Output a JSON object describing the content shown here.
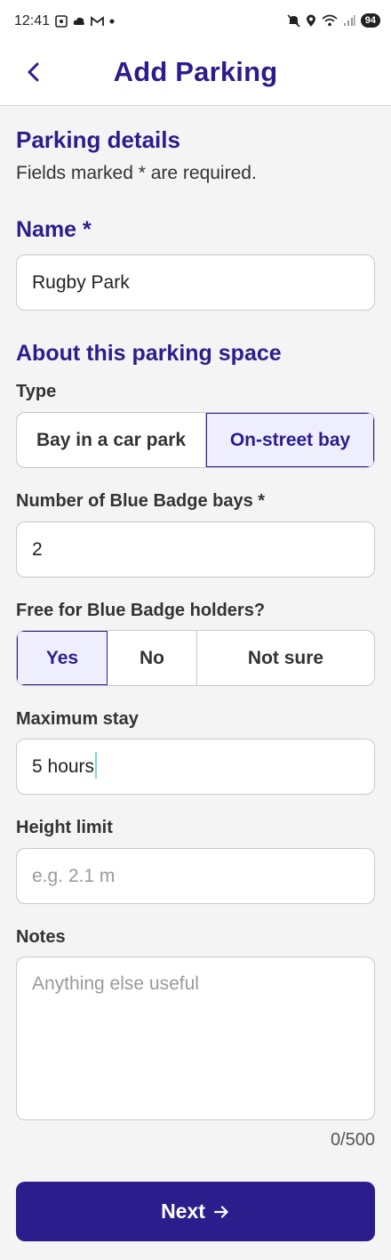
{
  "status_bar": {
    "time": "12:41",
    "battery": "94"
  },
  "app_bar": {
    "title": "Add Parking",
    "back_icon": "chevron-left-icon"
  },
  "form": {
    "section_title": "Parking details",
    "required_note": "Fields marked * are required.",
    "name": {
      "label": "Name *",
      "value": "Rugby Park"
    },
    "about_title": "About this parking space",
    "type": {
      "label": "Type",
      "options": [
        "Bay in a car park",
        "On-street bay"
      ],
      "selected": "On-street bay"
    },
    "bays": {
      "label": "Number of Blue Badge bays *",
      "value": "2"
    },
    "free": {
      "label": "Free for Blue Badge holders?",
      "options": [
        "Yes",
        "No",
        "Not sure"
      ],
      "selected": "Yes"
    },
    "max_stay": {
      "label": "Maximum stay",
      "value": "5 hours"
    },
    "height": {
      "label": "Height limit",
      "placeholder": "e.g. 2.1 m"
    },
    "notes": {
      "label": "Notes",
      "placeholder": "Anything else useful",
      "counter": "0/500"
    },
    "next_button": {
      "label": "Next",
      "icon": "arrow-right-icon"
    }
  },
  "colors": {
    "accent": "#2b1e8c",
    "selected_bg": "#efeefc",
    "page_bg": "#f4f4f4"
  }
}
